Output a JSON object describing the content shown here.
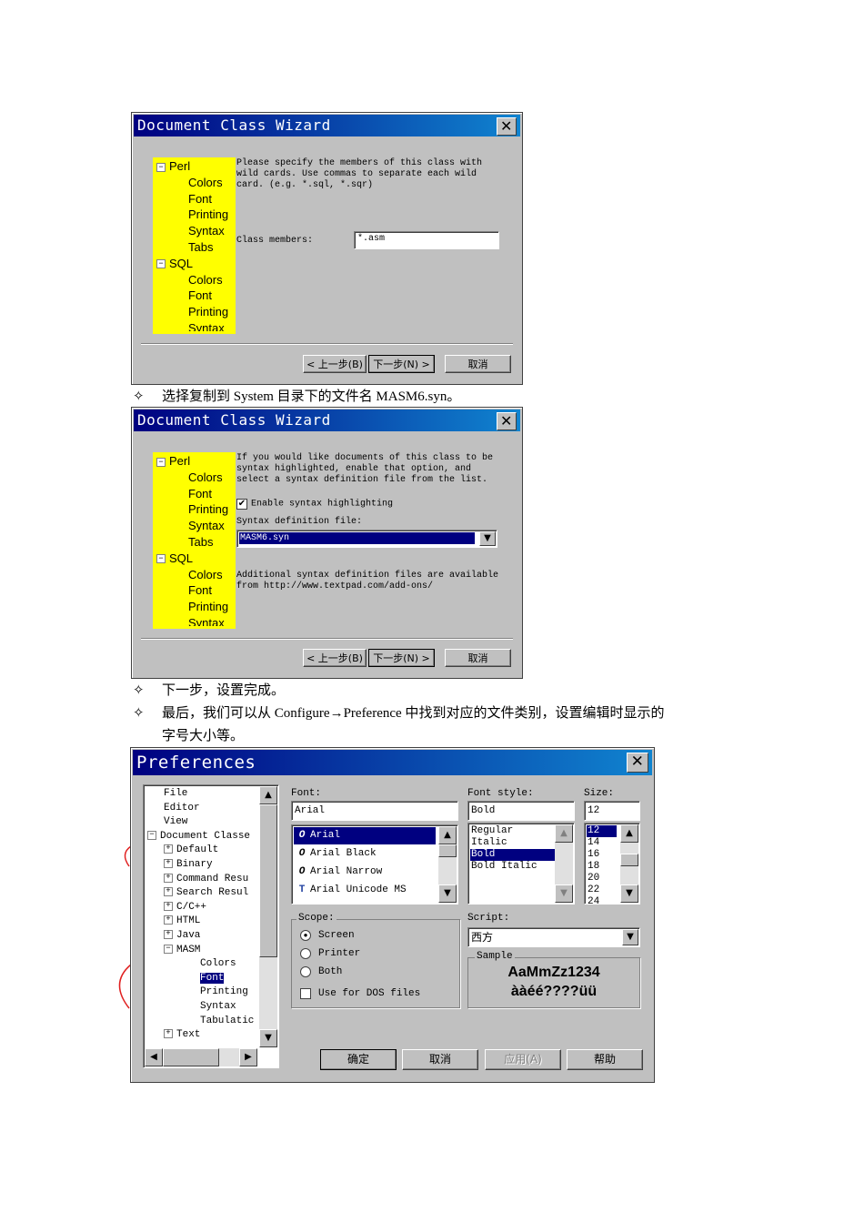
{
  "wizard1": {
    "title": "Document Class Wizard",
    "close": "✕",
    "tree": [
      "Perl",
      "Colors",
      "Font",
      "Printing",
      "Syntax",
      "Tabs",
      "SQL",
      "Colors",
      "Font",
      "Printing",
      "Syntax"
    ],
    "instructions": "Please specify the members of this class with wild cards.  Use commas to separate each wild card.  (e.g. *.sql, *.sqr)",
    "members_label": "Class members:",
    "members_value": "*.asm",
    "back": "< 上一步(B)",
    "next": "下一步(N) >",
    "cancel": "取消"
  },
  "para1": "选择复制到 System 目录下的文件名 MASM6.syn。",
  "wizard2": {
    "title": "Document Class Wizard",
    "close": "✕",
    "tree": [
      "Perl",
      "Colors",
      "Font",
      "Printing",
      "Syntax",
      "Tabs",
      "SQL",
      "Colors",
      "Font",
      "Printing",
      "Syntax"
    ],
    "instructions": "If you would like documents of this class to be syntax highlighted, enable that option, and select a syntax definition file from the list.",
    "enable_label": "Enable syntax highlighting",
    "syntax_file_label": "Syntax definition file:",
    "syntax_file_value": "MASM6.syn",
    "additional": "Additional syntax definition files are available from http://www.textpad.com/add-ons/",
    "back": "< 上一步(B)",
    "next": "下一步(N) >",
    "cancel": "取消"
  },
  "para2": "下一步，设置完成。",
  "para3a": "最后，我们可以从 Configure→Preference 中找到对应的文件类别，设置编辑时显示的",
  "para3b": "字号大小等。",
  "prefs": {
    "title": "Preferences",
    "close": "✕",
    "tree": [
      "File",
      "Editor",
      "View",
      "Document Classe",
      "Default",
      "Binary",
      "Command Resu",
      "Search Resul",
      "C/C++",
      "HTML",
      "Java",
      "MASM",
      "Colors",
      "Font",
      "Printing",
      "Syntax",
      "Tabulatic",
      "Text"
    ],
    "font_label": "Font:",
    "font_value": "Arial",
    "fonts": [
      "Arial",
      "Arial Black",
      "Arial Narrow",
      "Arial Unicode MS"
    ],
    "style_label": "Font style:",
    "style_value": "Bold",
    "styles": [
      "Regular",
      "Italic",
      "Bold",
      "Bold Italic"
    ],
    "size_label": "Size:",
    "size_value": "12",
    "sizes": [
      "12",
      "14",
      "16",
      "18",
      "20",
      "22",
      "24"
    ],
    "scope_label": "Scope:",
    "scope_screen": "Screen",
    "scope_printer": "Printer",
    "scope_both": "Both",
    "dos_label": "Use for DOS files",
    "script_label": "Script:",
    "script_value": "西方",
    "sample_label": "Sample",
    "sample_line1": "AaMmZz1234",
    "sample_line2": "ààéé????üü",
    "ok": "确定",
    "cancel": "取消",
    "apply": "应用(A)",
    "help": "帮助"
  },
  "bullet": "✧"
}
